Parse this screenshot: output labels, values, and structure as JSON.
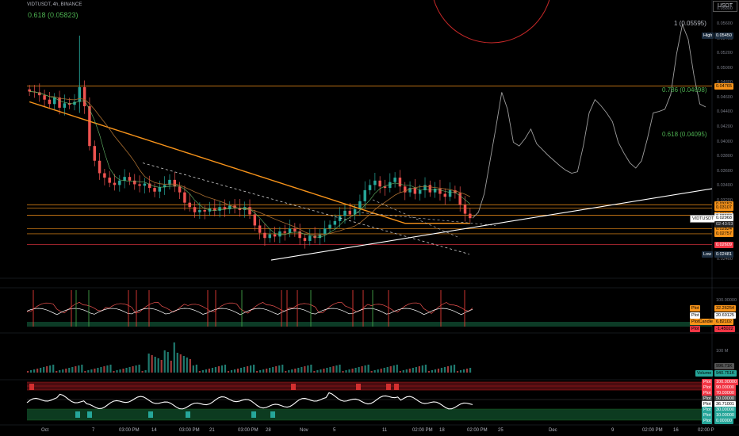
{
  "symbol_line": "VIDTUSDT, 4h, BINANCE",
  "currency": "USDT",
  "fib_top_label": "0.618 (0.05823)",
  "chart_data": {
    "type": "candlestick",
    "symbol": "VIDTUSDT",
    "exchange": "BINANCE",
    "timeframe": "4h",
    "y_axis_labels": [
      "0.05800",
      "0.05600",
      "0.05400",
      "0.05200",
      "0.05000",
      "0.04800",
      "0.04600",
      "0.04400",
      "0.04200",
      "0.04000",
      "0.03800",
      "0.03600",
      "0.03400",
      "0.03200",
      "0.03000",
      "0.02800",
      "0.02600",
      "0.02400"
    ],
    "ylim": [
      0.0225,
      0.0588
    ],
    "x_axis_labels": [
      "Oct",
      "7",
      "03:00 PM",
      "14",
      "03:00 PM",
      "21",
      "03:00 PM",
      "28",
      "Nov",
      "5",
      "11",
      "02:00 PM",
      "18",
      "02:00 PM",
      "25",
      "Dec",
      "9",
      "02:00 PM",
      "16",
      "02:00 P"
    ],
    "price_close": [
      0.0469,
      0.0468,
      0.0464,
      0.0458,
      0.0452,
      0.0461,
      0.0447,
      0.0453,
      0.0451,
      0.0455,
      0.0475,
      0.0449,
      0.0395,
      0.0375,
      0.0358,
      0.0352,
      0.0345,
      0.0342,
      0.0348,
      0.0353,
      0.0348,
      0.0343,
      0.0341,
      0.0344,
      0.0338,
      0.0333,
      0.0339,
      0.0342,
      0.0349,
      0.034,
      0.0332,
      0.0318,
      0.0312,
      0.0305,
      0.0308,
      0.0306,
      0.031,
      0.0307,
      0.0312,
      0.0309,
      0.0314,
      0.0311,
      0.0308,
      0.0312,
      0.0302,
      0.0287,
      0.0277,
      0.027,
      0.0275,
      0.0272,
      0.0279,
      0.0277,
      0.0283,
      0.0279,
      0.027,
      0.0266,
      0.0273,
      0.027,
      0.0275,
      0.0283,
      0.0288,
      0.0293,
      0.03,
      0.0307,
      0.0302,
      0.0309,
      0.032,
      0.0335,
      0.0342,
      0.0348,
      0.034,
      0.0338,
      0.0346,
      0.0352,
      0.034,
      0.0332,
      0.0338,
      0.033,
      0.0335,
      0.0342,
      0.0332,
      0.0337,
      0.033,
      0.0326,
      0.0335,
      0.0331,
      0.0315,
      0.0303,
      0.0297
    ],
    "projection": [
      0.0297,
      0.0305,
      0.033,
      0.0375,
      0.042,
      0.0468,
      0.0445,
      0.04,
      0.0395,
      0.0405,
      0.0418,
      0.0398,
      0.039,
      0.0382,
      0.0375,
      0.0368,
      0.0362,
      0.0358,
      0.036,
      0.0395,
      0.044,
      0.0458,
      0.045,
      0.044,
      0.0428,
      0.04,
      0.0385,
      0.0372,
      0.0365,
      0.0375,
      0.0405,
      0.044,
      0.0442,
      0.0445,
      0.0465,
      0.052,
      0.056,
      0.054,
      0.049,
      0.0452,
      0.0448
    ],
    "horizontal_levels": [
      {
        "value": 0.04765,
        "label": "0.04765",
        "color": "#f7931a"
      },
      {
        "value": 0.03152,
        "label": "0.03152",
        "color": "#f7931a"
      },
      {
        "value": 0.03107,
        "label": "0.03107",
        "color": "#f7931a"
      },
      {
        "value": 0.03011,
        "label": "0.03011",
        "color": "#f7931a"
      },
      {
        "value": 0.02824,
        "label": "0.02824",
        "color": "#f7931a"
      },
      {
        "value": 0.02757,
        "label": "0.02757",
        "color": "#f7931a"
      },
      {
        "value": 0.02609,
        "label": "0.02609",
        "color": "#f23645"
      }
    ],
    "fib_labels": [
      {
        "value": 0.05595,
        "label": "1 (0.05595)",
        "color": "#b2b5be"
      },
      {
        "value": 0.04698,
        "label": "0.786 (0.04698)",
        "color": "#4caf50"
      },
      {
        "value": 0.04095,
        "label": "0.618 (0.04095)",
        "color": "#4caf50"
      }
    ],
    "price_tags": [
      {
        "value": 0.0545,
        "label": "High",
        "price": "0.05450",
        "color": "#1c2d3f",
        "text": "#ffffff"
      },
      {
        "value": 0.04765,
        "label": "",
        "price": "0.04765",
        "color": "#f7931a",
        "text": "#000000"
      },
      {
        "value": 0.03152,
        "label": "",
        "price": "0.03152",
        "color": "#f7931a",
        "text": "#000000"
      },
      {
        "value": 0.03107,
        "label": "",
        "price": "0.03107",
        "color": "#f7931a",
        "text": "#000000"
      },
      {
        "value": 0.03011,
        "label": "",
        "price": "0.03011",
        "color": "#f7931a",
        "text": "#000000"
      },
      {
        "value": 0.02998,
        "label": "",
        "price": "0.02998",
        "color": "#e0e0e0",
        "text": "#000000"
      },
      {
        "value": 0.02824,
        "label": "",
        "price": "0.02824",
        "color": "#f7931a",
        "text": "#000000"
      },
      {
        "value": 0.02757,
        "label": "",
        "price": "0.02757",
        "color": "#f7931a",
        "text": "#000000"
      },
      {
        "value": 0.02609,
        "label": "",
        "price": "0.02609",
        "color": "#f23645",
        "text": "#ffffff"
      },
      {
        "value": 0.02481,
        "label": "Low",
        "price": "0.02481",
        "color": "#1c2d3f",
        "text": "#ffffff"
      }
    ],
    "last_price": {
      "symbol": "VIDTUSDT",
      "price": "0.02968",
      "countdown": "02:43:53",
      "value": 0.02968
    },
    "oscillator_tags": [
      {
        "text": "Plot",
        "value": "32.26254",
        "color": "#f7931a"
      },
      {
        "text": "Plot",
        "value": "20.69125",
        "color": "#ffffff"
      },
      {
        "text": "PlotCandle",
        "value": "6.82102",
        "color": "#f7931a"
      },
      {
        "text": "Plot",
        "value": "-1.45022",
        "color": "#f23645"
      }
    ],
    "oscillator_axis": "100.00000",
    "volume_axis": "100 M",
    "volume_tags": [
      {
        "text": "",
        "value": "996.71K",
        "color": "#555555"
      },
      {
        "text": "Volume",
        "value": "940.751K",
        "color": "#26a69a"
      }
    ],
    "rsi_tags": [
      {
        "text": "Plot",
        "value": "100.00000",
        "color": "#f23645"
      },
      {
        "text": "Plot",
        "value": "90.00000",
        "color": "#f23645"
      },
      {
        "text": "Plot",
        "value": "70.00000",
        "color": "#f23645"
      },
      {
        "text": "Plot",
        "value": "50.00000",
        "color": "#4a4a4a"
      },
      {
        "text": "Plot",
        "value": "36.71001",
        "color": "#ffffff"
      },
      {
        "text": "Plot",
        "value": "30.00000",
        "color": "#26a69a"
      },
      {
        "text": "Plot",
        "value": "10.00000",
        "color": "#26a69a"
      },
      {
        "text": "Plot",
        "value": "0.00000",
        "color": "#26a69a"
      }
    ],
    "colors": {
      "up": "#26a69a",
      "down": "#ef5350",
      "ma200": "#f7931a",
      "trend": "#ffffff",
      "fib": "#4caf50"
    }
  }
}
